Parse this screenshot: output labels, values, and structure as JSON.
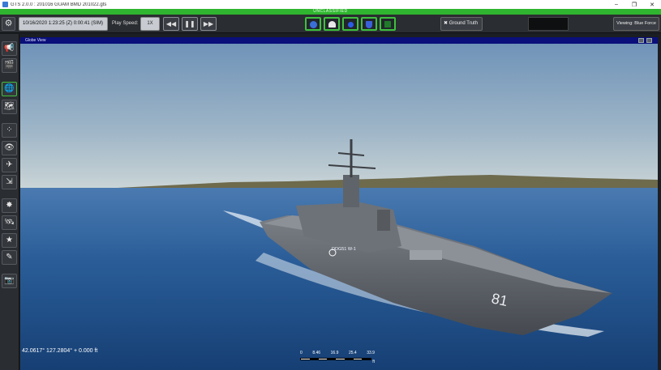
{
  "window": {
    "title": "GTS 2.0.0 : 201016 GUAM BMD 201022.gts",
    "buttons": [
      "–",
      "❐",
      "✕"
    ]
  },
  "classification": "UNCLASSIFIED",
  "toolbar": {
    "datetime": "10/16/2020 1:23:25 (Z) 0:00:41 (SIM)",
    "play_speed_label": "Play Speed:",
    "play_speed_value": "1X",
    "ground_truth_label": "Ground Truth",
    "viewing_label": "Viewing: Blue Force"
  },
  "viewport": {
    "title": "Globe View",
    "coordinates": "42.0617° 127.2804° + 0.000 ft",
    "ship_label": "DDG51 W-1",
    "hull_number": "81",
    "scale": {
      "ticks": [
        "0",
        "8.46",
        "16.9",
        "25.4",
        "33.9"
      ],
      "unit": "ft"
    }
  },
  "colors": {
    "accent_green": "#3ec13e",
    "classification_green": "#2fb52f",
    "viewport_title_blue": "#0a0f7a"
  }
}
